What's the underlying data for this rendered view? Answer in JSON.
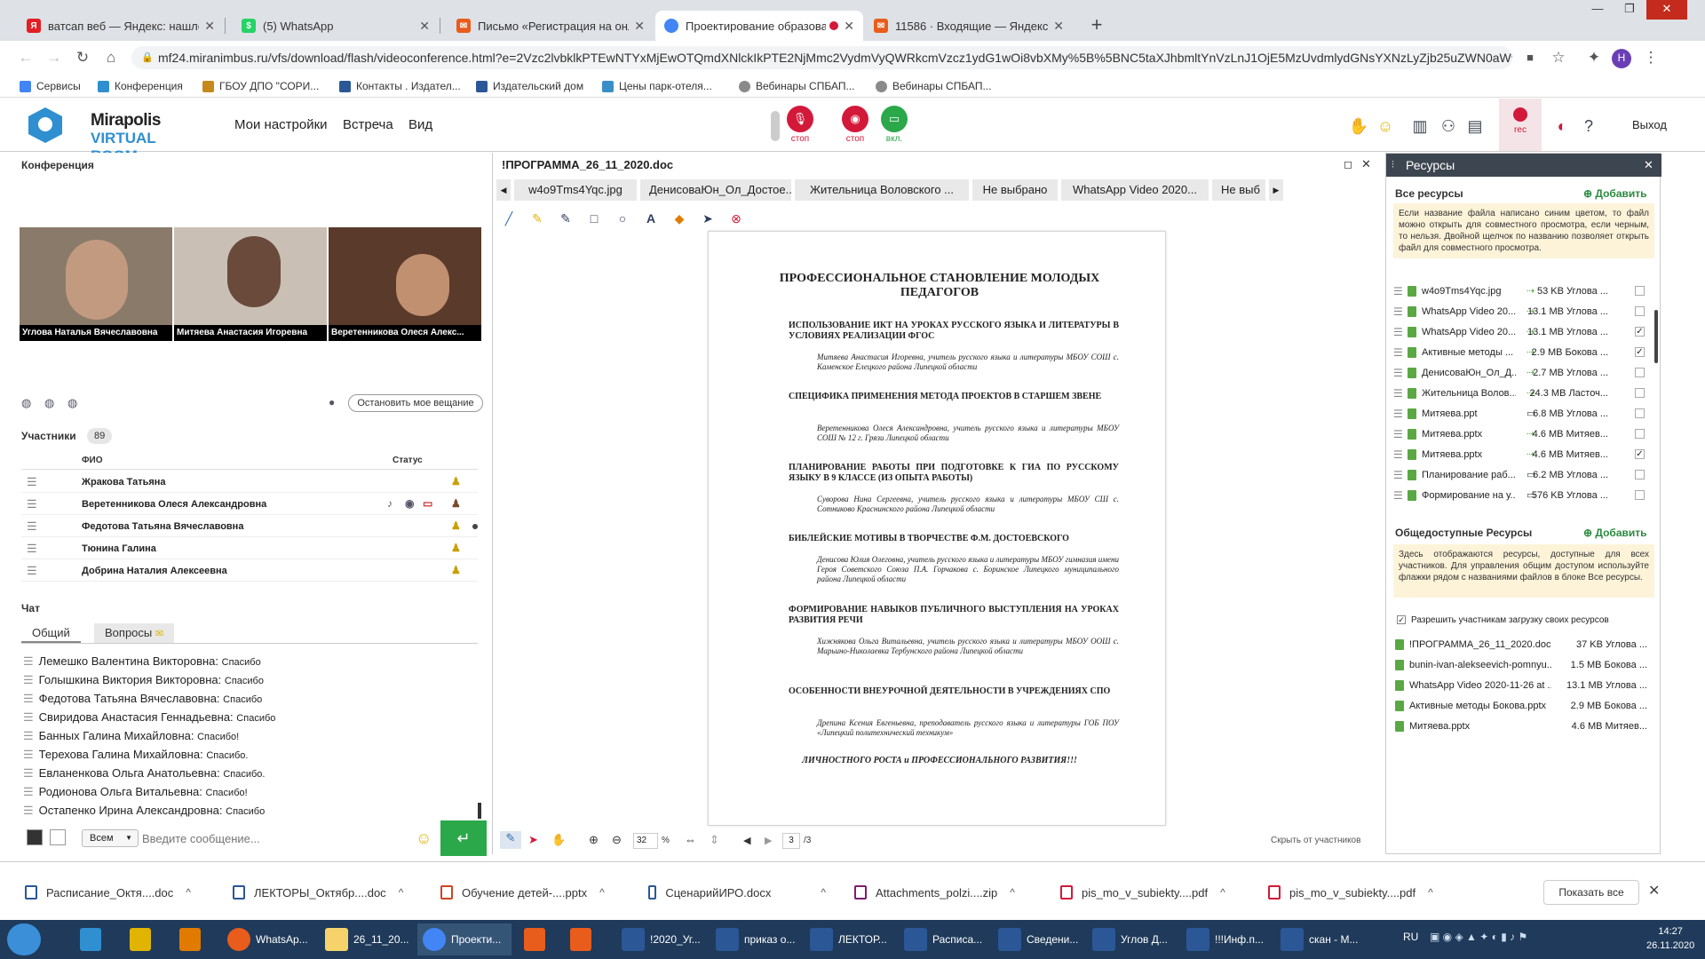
{
  "browser": {
    "tabs": [
      {
        "label": "ватсап веб — Яндекс: нашлось",
        "color": "#e31e24",
        "glyph": "Я"
      },
      {
        "label": "(5) WhatsApp",
        "color": "#25d366",
        "glyph": "$"
      },
      {
        "label": "Письмо «Регистрация на онлай",
        "color": "#e85c1c",
        "glyph": "✉"
      },
      {
        "label": "Проектирование образова",
        "color": "#4285f4",
        "glyph": "●"
      },
      {
        "label": "11586 · Входящие — Яндекс.По",
        "color": "#e85c1c",
        "glyph": "✉"
      }
    ],
    "url": "mf24.miranimbus.ru/vfs/download/flash/videoconference.html?e=2Vzc2lvbklkPTEwNTYxMjEwOTQmdXNlckIkPTE2NjMmc2VydmVyQWRkcmVzcz1ydG1wOi8vbXMy%5B%5BNC5taXJhbmltYnVzLnJ1OjE5MzUvdmlydGNsYXNzLyZjb25uZWN0aW9u...",
    "bookmarks": [
      "Сервисы",
      "Конференция",
      "ГБОУ ДПО \"СОРИ...",
      "Контакты . Издател...",
      "Издательский дом",
      "Цены парк-отеля...",
      "Вебинары СПБАП...",
      "Вебинары СПБАП..."
    ],
    "profile_initial": "Н"
  },
  "app": {
    "logo_line1": "Mirapolis",
    "logo_line2": "VIRTUAL ROOM",
    "menu": [
      "Мои настройки",
      "Встреча",
      "Вид"
    ],
    "mic_label": "стоп",
    "cam_label": "стоп",
    "screen_label": "вкл.",
    "rec_label": "rec",
    "exit_label": "Выход"
  },
  "conference": {
    "title": "Конференция",
    "videos": [
      {
        "name": "Углова Наталья Вячеславовна",
        "bg": "#8a7a6a"
      },
      {
        "name": "Митяева Анастасия Игоревна",
        "bg": "#c9bfb5"
      },
      {
        "name": "Веретенникова Олеся Алекс...",
        "bg": "#5a3a2a"
      }
    ],
    "stop_button": "Остановить мое вещание"
  },
  "participants": {
    "title": "Участники",
    "count": "89",
    "col_name": "ФИО",
    "col_status": "Статус",
    "rows": [
      "Жракова Татьяна",
      "Веретенникова Олеся  Александровна",
      "Федотова Татьяна  Вячеславовна",
      "Тюнина Галина",
      "Добрина Наталия  Алексеевна"
    ]
  },
  "chat": {
    "title": "Чат",
    "tab_general": "Общий",
    "tab_questions": "Вопросы",
    "messages": [
      {
        "name": "Лемешко Валентина   Викторовна:",
        "text": "Спасибо"
      },
      {
        "name": "Голышкина Виктория Викторовна:",
        "text": "Спасибо"
      },
      {
        "name": "Федотова Татьяна  Вячеславовна:",
        "text": "Спасибо"
      },
      {
        "name": "Свиридова  Анастасия   Геннадьевна:",
        "text": "Спасибо"
      },
      {
        "name": "Банных Галина  Михайловна:",
        "text": "Спасибо!"
      },
      {
        "name": "Терехова Галина Михайловна:",
        "text": "Спасибо."
      },
      {
        "name": "Евланенкова Ольга  Анатольевна:",
        "text": "Спасибо."
      },
      {
        "name": "Родионова Ольга Витальевна:",
        "text": "Спасибо!"
      },
      {
        "name": "Остапенко Ирина  Александровна:",
        "text": "Спасибо"
      }
    ],
    "recipient": "Всем",
    "input_placeholder": "Введите сообщение..."
  },
  "document": {
    "title": "!ПРОГРАММА_26_11_2020.doc",
    "tabs": [
      "w4o9Tms4Yqc.jpg",
      "ДенисоваЮн_Ол_Достое...",
      "Жительница Воловского ...",
      "Не выбрано",
      "WhatsApp Video 2020...",
      "Не выб"
    ],
    "page_title": "ПРОФЕССИОНАЛЬНОЕ СТАНОВЛЕНИЕ МОЛОДЫХ ПЕДАГОГОВ",
    "sections": [
      {
        "heading": "ИСПОЛЬЗОВАНИЕ ИКТ НА УРОКАХ РУССКОГО ЯЗЫКА И ЛИТЕРАТУРЫ В УСЛОВИЯХ РЕАЛИЗАЦИИ ФГОС",
        "author": "Митяева Анастасия Игоревна, учитель русского языка и литературы МБОУ СОШ с. Каменское Елецкого района Липецкой области"
      },
      {
        "heading": "СПЕЦИФИКА ПРИМЕНЕНИЯ МЕТОДА ПРОЕКТОВ В СТАРШЕМ ЗВЕНЕ",
        "author": "Веретенникова Олеся Александровна, учитель русского языка и литературы МБОУ СОШ № 12 г. Грязи Липецкой области"
      },
      {
        "heading": "ПЛАНИРОВАНИЕ РАБОТЫ ПРИ ПОДГОТОВКЕ К ГИА ПО РУССКОМУ ЯЗЫКУ В 9 КЛАССЕ (ИЗ ОПЫТА РАБОТЫ)",
        "author": "Суворова Нина Сергеевна, учитель русского языка и литературы МБОУ СШ с. Сотниково Краснинского района Липецкой области"
      },
      {
        "heading": "БИБЛЕЙСКИЕ МОТИВЫ В ТВОРЧЕСТВЕ Ф.М. ДОСТОЕВСКОГО",
        "author": "Денисова Юлия Олеговна, учитель русского языка и литературы МБОУ гимназия имени Героя Советского Союза П.А. Горчакова с. Боринское Липецкого муниципального района Липецкой области"
      },
      {
        "heading": "ФОРМИРОВАНИЕ НАВЫКОВ ПУБЛИЧНОГО ВЫСТУПЛЕНИЯ НА УРОКАХ РАЗВИТИЯ РЕЧИ",
        "author": "Хижнякова Ольга Витальевна, учитель русского языка и литературы МБОУ ООШ с. Марьино-Николаевка Тербунского района Липецкой области"
      },
      {
        "heading": "ОСОБЕННОСТИ ВНЕУРОЧНОЙ ДЕЯТЕЛЬНОСТИ В УЧРЕЖДЕНИЯХ СПО",
        "author": "Дрепина Ксения Евгеньевна, преподаватель русского языка и литературы ГОБ ПОУ «Липецкий политехнический техникум»"
      }
    ],
    "closing": "ЛИЧНОСТНОГО РОСТА и ПРОФЕССИОНАЛЬНОГО РАЗВИТИЯ!!!",
    "zoom": "32",
    "zoom_unit": "%",
    "page_num": "3",
    "page_total": "/3",
    "hide_label": "Скрыть от участников"
  },
  "resources": {
    "title": "Ресурсы",
    "all_title": "Все ресурсы",
    "add_label": "Добавить",
    "all_note": "Если название файла написано синим цветом, то файл можно открыть для совместного просмотра, если черным, то нельзя. Двойной щелчок по названию позволяет открыть файл для совместного просмотра.",
    "files": [
      {
        "name": "w4o9Tms4Yqc.jpg",
        "size": "53 KB Углова ...",
        "checked": ""
      },
      {
        "name": "WhatsApp Video 20...",
        "size": "13.1 MB Углова ...",
        "checked": ""
      },
      {
        "name": "WhatsApp Video 20...",
        "size": "13.1 MB Углова ...",
        "checked": "✓"
      },
      {
        "name": "Активные методы ...",
        "size": "2.9 MB Бокова ...",
        "checked": "✓"
      },
      {
        "name": "ДенисоваЮн_Ол_Д...",
        "size": "2.7 MB Углова ...",
        "checked": ""
      },
      {
        "name": "Жительница Волов...",
        "size": "24.3 MB Ласточ...",
        "checked": ""
      },
      {
        "name": "Митяева.ppt",
        "size": "6.8 MB Углова ...",
        "checked": ""
      },
      {
        "name": "Митяева.pptx",
        "size": "4.6 MB Митяев...",
        "checked": ""
      },
      {
        "name": "Митяева.pptx",
        "size": "4.6 MB Митяев...",
        "checked": "✓"
      },
      {
        "name": "Планирование раб...",
        "size": "6.2 MB Углова ...",
        "checked": ""
      },
      {
        "name": "Формирование на у...",
        "size": "576 KB Углова ...",
        "checked": ""
      }
    ],
    "public_title": "Общедоступные Ресурсы",
    "public_note": "Здесь отображаются ресурсы, доступные для всех участников. Для управления общим доступом используйте флажки рядом с названиями файлов в блоке Все ресурсы.",
    "allow_label": "Разрешить участникам загрузку своих ресурсов",
    "public_files": [
      {
        "name": "!ПРОГРАММА_26_11_2020.doc",
        "size": "37 KB Углова ..."
      },
      {
        "name": "bunin-ivan-alekseevich-pomnyu...",
        "size": "1.5 MB Бокова ..."
      },
      {
        "name": "WhatsApp Video 2020-11-26 at ...",
        "size": "13.1 MB Углова ..."
      },
      {
        "name": "Активные методы Бокова.pptx",
        "size": "2.9 MB Бокова ..."
      },
      {
        "name": "Митяева.pptx",
        "size": "4.6 MB Митяев..."
      }
    ]
  },
  "downloads": {
    "items": [
      "Расписание_Октя....doc",
      "ЛЕКТОРЫ_Октябр....doc",
      "Обучение детей-....pptx",
      "СценарийИРО.docx",
      "Attachments_polzi....zip",
      "pis_mo_v_subiekty....pdf",
      "pis_mo_v_subiekty....pdf"
    ],
    "show_all": "Показать все"
  },
  "taskbar": {
    "items": [
      "WhatsAp...",
      "26_11_20...",
      "Проекти...",
      "",
      "",
      "!2020_Уг...",
      "приказ о...",
      "ЛЕКТОР...",
      "Расписа...",
      "Сведени...",
      "Углов Д...",
      "!!!Инф.п...",
      "скан - М..."
    ],
    "lang": "RU",
    "time": "14:27",
    "date": "26.11.2020"
  }
}
